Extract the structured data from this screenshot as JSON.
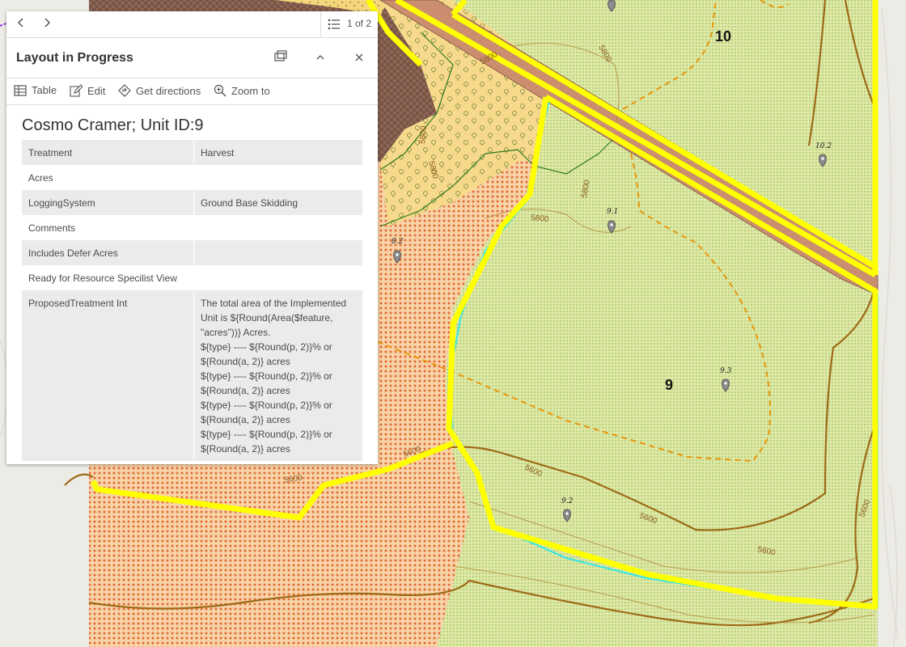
{
  "map": {
    "unit_labels": [
      "10",
      "9"
    ],
    "point_labels": [
      "10.2",
      "9.1",
      "8.2",
      "9.3",
      "9.2"
    ],
    "contour_labels": [
      "5800",
      "5800",
      "5800",
      "5800",
      "5800",
      "5800",
      "5600",
      "5600",
      "5600",
      "5600",
      "5600",
      "5600"
    ]
  },
  "popup": {
    "page_indicator": "1 of 2",
    "title": "Layout in Progress",
    "actions": [
      "Table",
      "Edit",
      "Get directions",
      "Zoom to"
    ],
    "feature_title": "Cosmo Cramer; Unit ID:9",
    "attributes": [
      {
        "key": "Treatment",
        "value": "Harvest"
      },
      {
        "key": "Acres",
        "value": ""
      },
      {
        "key": "LoggingSystem",
        "value": "Ground Base Skidding"
      },
      {
        "key": "Comments",
        "value": ""
      },
      {
        "key": "Includes Defer Acres",
        "value": ""
      },
      {
        "key": "Ready for Resource Specilist View",
        "value": ""
      },
      {
        "key": "ProposedTreatment Int",
        "value": "The total area of the Implemented Unit is ${Round(Area($feature, \"acres\"))} Acres.\n${type} ---- ${Round(p, 2)}% or ${Round(a, 2)} acres\n${type} ---- ${Round(p, 2)}% or ${Round(a, 2)} acres\n${type} ---- ${Round(p, 2)}% or ${Round(a, 2)} acres\n${type} ---- ${Round(p, 2)}% or ${Round(a, 2)} acres"
      }
    ]
  },
  "colors": {
    "unit_boundary": "#ffff00",
    "unit_outline_cyan": "#33e6e6",
    "harvest_fill": "#d8e6a0",
    "orange_fill": "#f5c89a",
    "road": "#c98a6e",
    "contour": "#a0680c",
    "treatment_dash": "#e8960a"
  }
}
